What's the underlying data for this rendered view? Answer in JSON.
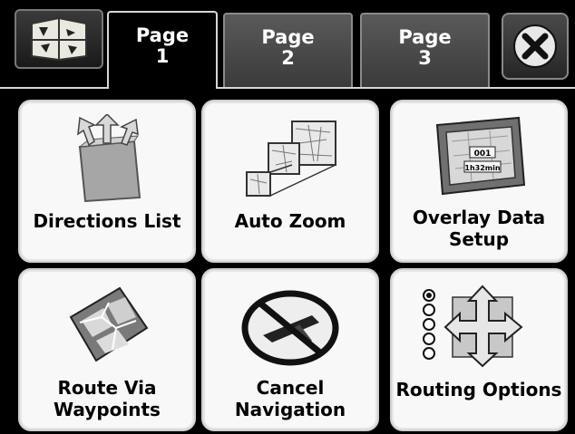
{
  "tabs": [
    {
      "line1": "Page",
      "line2": "1"
    },
    {
      "line1": "Page",
      "line2": "2"
    },
    {
      "line1": "Page",
      "line2": "3"
    }
  ],
  "menu": {
    "row1": [
      {
        "label": "Directions List"
      },
      {
        "label": "Auto Zoom"
      },
      {
        "label_line1": "Overlay Data",
        "label_line2": "Setup"
      }
    ],
    "row2": [
      {
        "label_line1": "Route Via",
        "label_line2": "Waypoints"
      },
      {
        "label_line1": "Cancel",
        "label_line2": "Navigation"
      },
      {
        "label": "Routing Options"
      }
    ]
  },
  "overlay_text": {
    "line1": "001",
    "line2": "1h32min"
  }
}
